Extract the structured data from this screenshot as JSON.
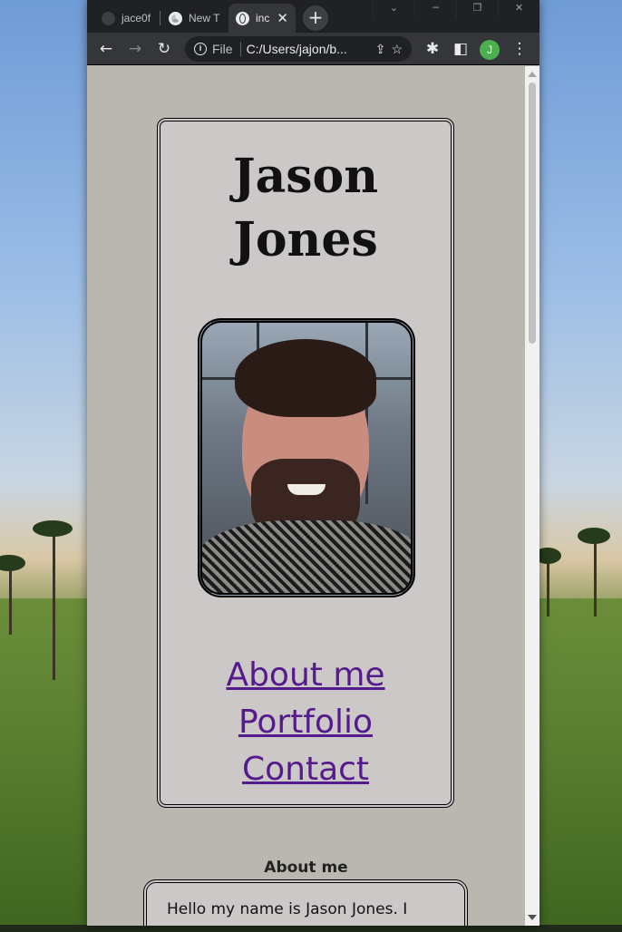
{
  "browser": {
    "tabs": [
      {
        "title": "jace0f",
        "active": false,
        "icon": "github-icon"
      },
      {
        "title": "New T",
        "active": false,
        "icon": "chrome-icon"
      },
      {
        "title": "inc",
        "active": true,
        "icon": "globe-icon"
      }
    ],
    "new_tab_symbol": "+",
    "window_controls": {
      "dropdown": "⌄",
      "minimize": "─",
      "restore": "❐",
      "close": "✕"
    },
    "omnibox": {
      "scheme_label": "File",
      "url": "C:/Users/jajon/b..."
    },
    "profile_initial": "J",
    "accent_color": "#4caf50"
  },
  "page": {
    "name": "Jason Jones",
    "photo_alt": "portrait-photo",
    "nav": {
      "about": "About me",
      "portfolio": "Portfolio",
      "contact": "Contact"
    },
    "link_color": "#551a8b",
    "about_section": {
      "title": "About me",
      "text": "Hello my name is Jason Jones. I"
    }
  }
}
